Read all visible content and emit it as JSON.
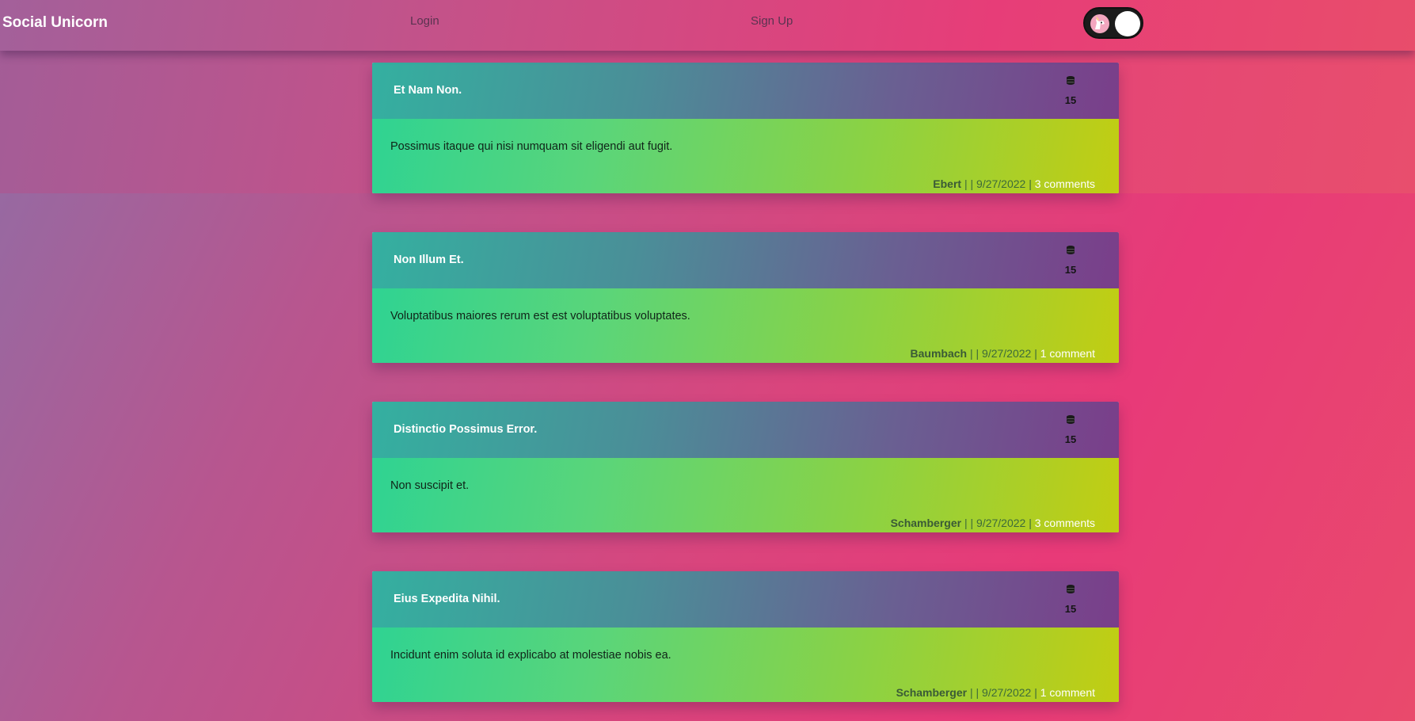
{
  "navbar": {
    "brand": "Social Unicorn",
    "login_label": "Login",
    "signup_label": "Sign Up",
    "theme_toggle_icon": "unicorn-icon"
  },
  "posts": [
    {
      "title": "Et Nam Non.",
      "points": "15",
      "body": "Possimus itaque qui nisi numquam sit eligendi aut fugit.",
      "author": "Ebert",
      "separator": " | | ",
      "date": "9/27/2022",
      "separator2": " | ",
      "comments": "3 comments"
    },
    {
      "title": "Non Illum Et.",
      "points": "15",
      "body": "Voluptatibus maiores rerum est est voluptatibus voluptates.",
      "author": "Baumbach",
      "separator": " | | ",
      "date": "9/27/2022",
      "separator2": " | ",
      "comments": "1 comment"
    },
    {
      "title": "Distinctio Possimus Error.",
      "points": "15",
      "body": "Non suscipit et.",
      "author": "Schamberger",
      "separator": " | | ",
      "date": "9/27/2022",
      "separator2": " | ",
      "comments": "3 comments"
    },
    {
      "title": "Eius Expedita Nihil.",
      "points": "15",
      "body": "Incidunt enim soluta id explicabo at molestiae nobis ea.",
      "author": "Schamberger",
      "separator": " | | ",
      "date": "9/27/2022",
      "separator2": " | ",
      "comments": "1 comment"
    }
  ],
  "colors": {
    "card_head_start": "#34b0a0",
    "card_head_end": "#7a3e8a",
    "card_body_start": "#2fd392",
    "card_body_end": "#c2cd12",
    "page_accent": "#e83a78"
  }
}
